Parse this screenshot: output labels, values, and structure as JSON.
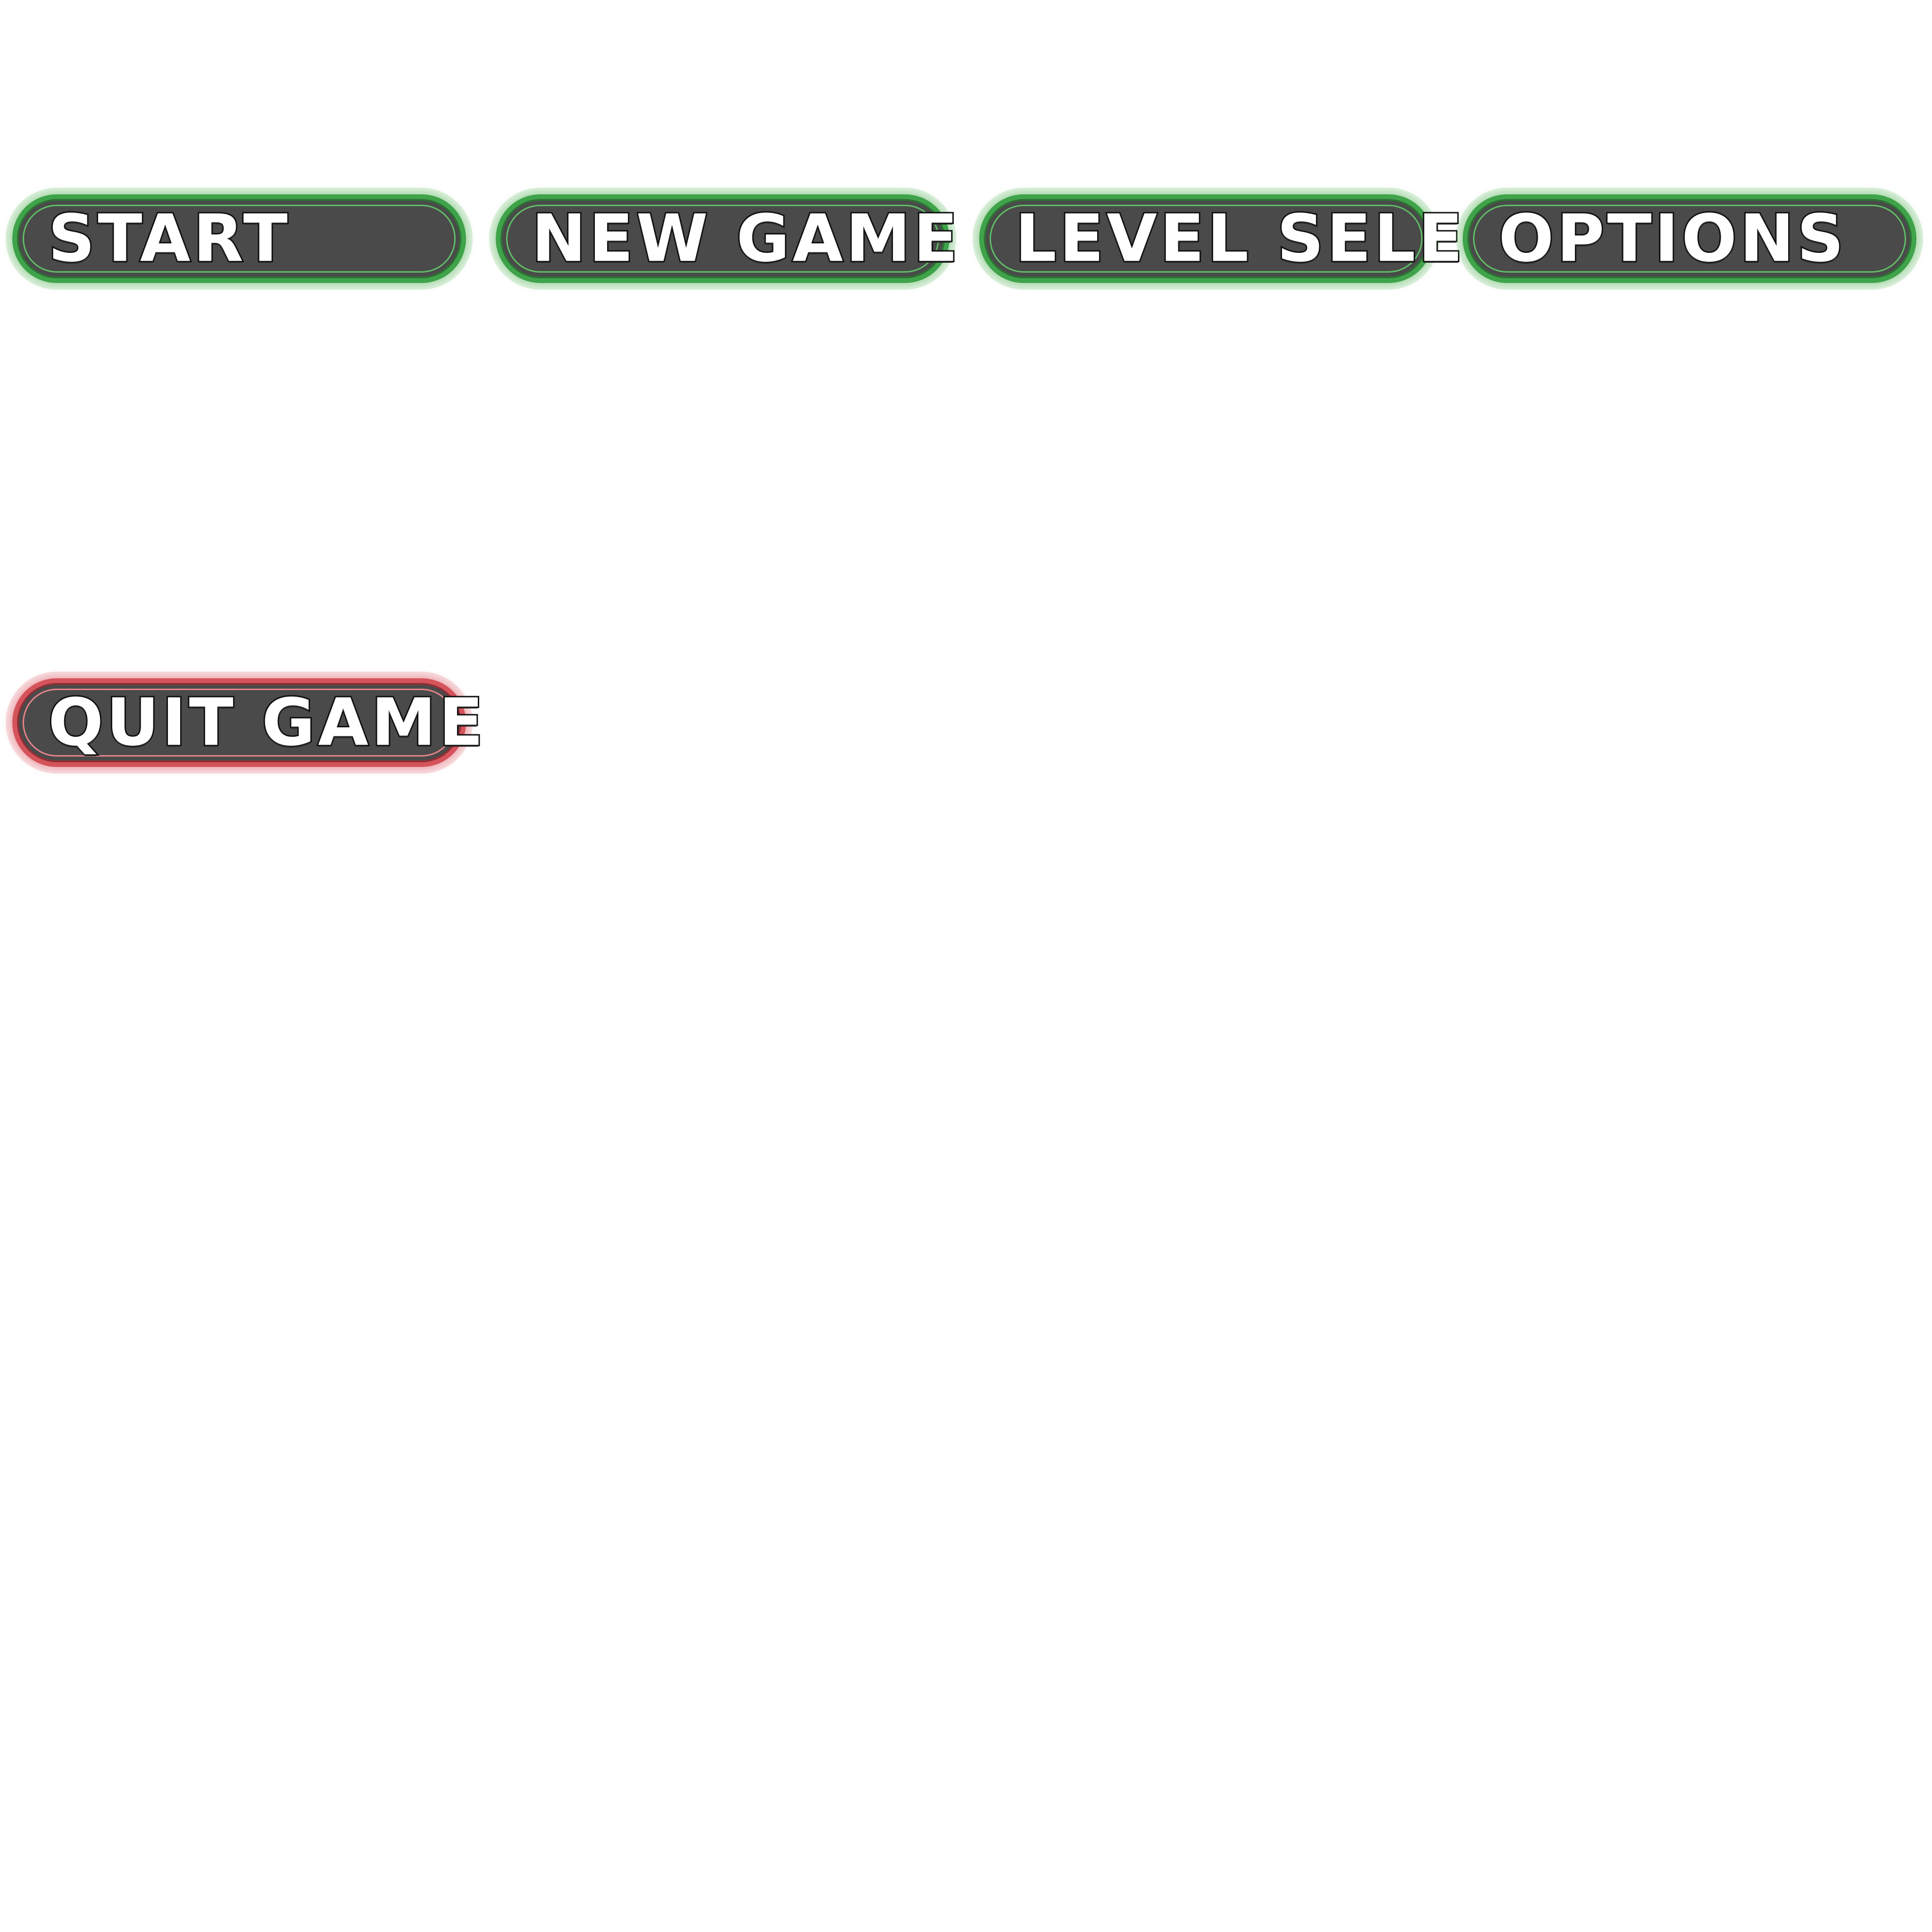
{
  "menu": {
    "buttons": [
      {
        "label": "START",
        "accent": "#3fa34a"
      },
      {
        "label": "NEW GAME",
        "accent": "#3fa34a"
      },
      {
        "label": "LEVEL SELECT",
        "accent": "#3fa34a"
      },
      {
        "label": "OPTiONS",
        "accent": "#3fa34a"
      },
      {
        "label": "QUiT GAME",
        "accent": "#d5535b"
      }
    ]
  }
}
